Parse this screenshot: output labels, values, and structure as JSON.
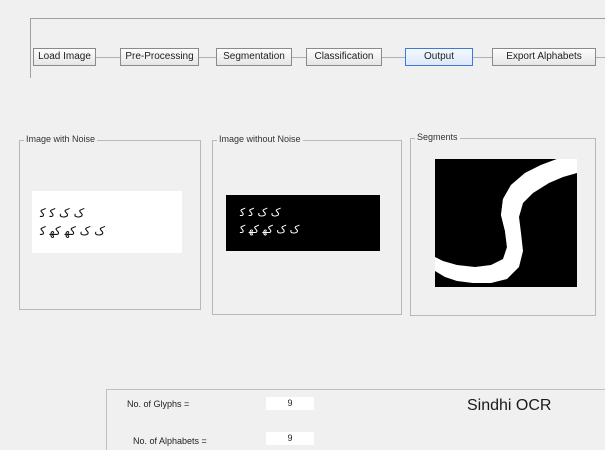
{
  "toolbar": {
    "buttons": [
      {
        "label": "Load Image",
        "active": false
      },
      {
        "label": "Pre-Processing",
        "active": false
      },
      {
        "label": "Segmentation",
        "active": false
      },
      {
        "label": "Classification",
        "active": false
      },
      {
        "label": "Output",
        "active": true
      },
      {
        "label": "Export Alphabets",
        "active": false
      }
    ]
  },
  "panels": {
    "noisy": {
      "title": "Image with Noise",
      "line1": "ﮎ ﮎ    ﮐ ﮐ",
      "line2": "ﮎ ﮎ  ﮐﮭ ﮐﮭ ﮐ"
    },
    "clean": {
      "title": "Image without Noise",
      "line1": "ﮎ ﮎ    ﮐ ﮐ",
      "line2": "ﮎ ﮎ  ﮐﮭ ﮐﮭ ﮐ"
    },
    "segments": {
      "title": "Segments"
    }
  },
  "stats": {
    "glyphs_label": "No. of Glyphs =",
    "glyphs_value": "9",
    "alphabets_label": "No. of Alphabets =",
    "alphabets_value": "9"
  },
  "app_title": "Sindhi OCR",
  "colors": {
    "active_border": "#3f7bd6",
    "window_bg": "#f0f0f0",
    "image_black": "#000000",
    "image_white": "#ffffff"
  }
}
